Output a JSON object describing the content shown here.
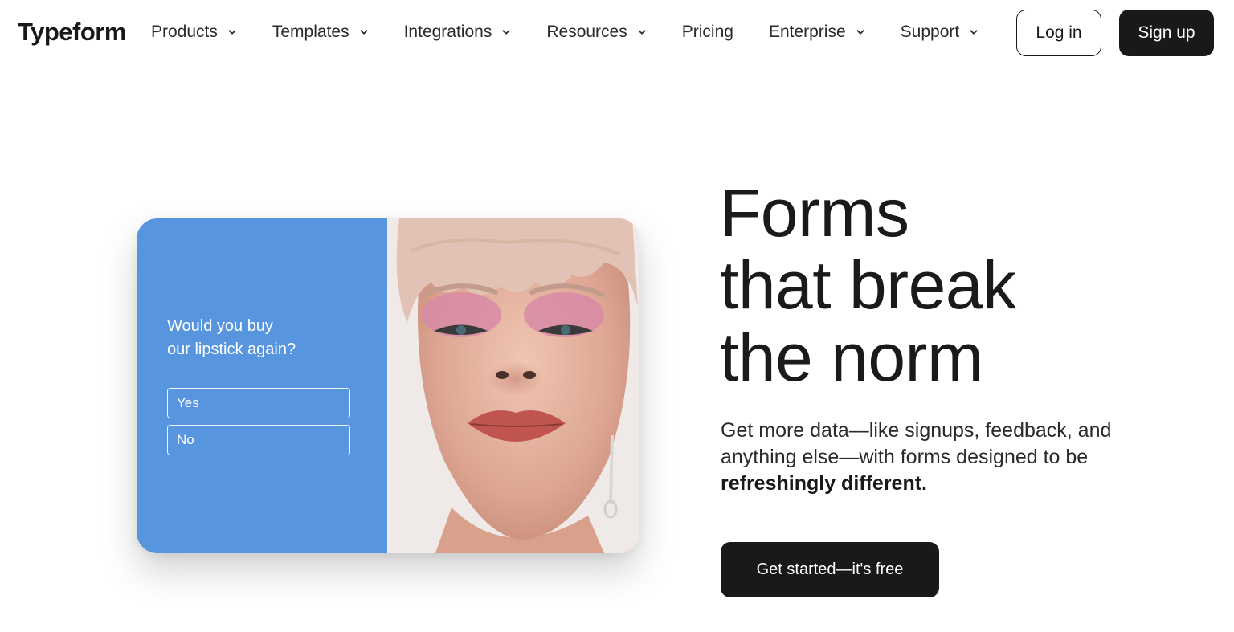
{
  "brand": {
    "logo_text": "Typeform"
  },
  "nav": {
    "items": [
      {
        "label": "Products",
        "has_dropdown": true
      },
      {
        "label": "Templates",
        "has_dropdown": true
      },
      {
        "label": "Integrations",
        "has_dropdown": true
      },
      {
        "label": "Resources",
        "has_dropdown": true
      },
      {
        "label": "Pricing",
        "has_dropdown": false
      },
      {
        "label": "Enterprise",
        "has_dropdown": true
      },
      {
        "label": "Support",
        "has_dropdown": true
      }
    ],
    "login_label": "Log in",
    "signup_label": "Sign up"
  },
  "hero_card": {
    "question_line1": "Would you buy",
    "question_line2": "our lipstick again?",
    "options": [
      "Yes",
      "No"
    ],
    "panel_color": "#5796df"
  },
  "hero": {
    "headline_line1": "Forms",
    "headline_line2": "that break",
    "headline_line3": "the norm",
    "subtext_regular": "Get more data—like signups, feedback, and anything else—with forms designed to be",
    "subtext_bold": "refreshingly different.",
    "cta_label": "Get started—it's free"
  },
  "colors": {
    "dark": "#191919",
    "accent_blue": "#5796df",
    "background": "#ffffff"
  }
}
